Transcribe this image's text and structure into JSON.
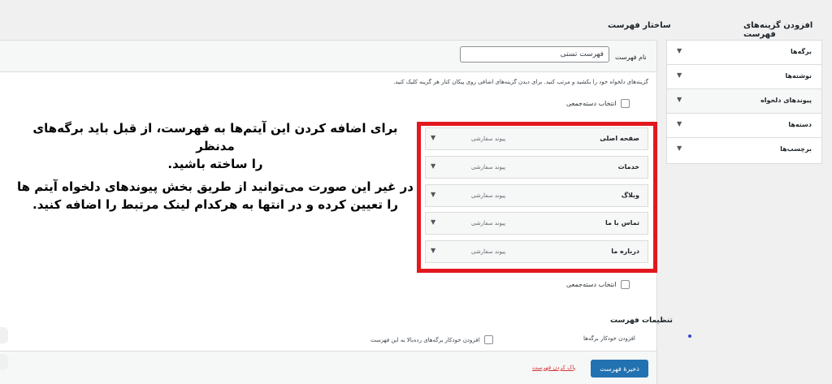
{
  "add_items_panel": {
    "title": "افزودن گزینه‌های فهرست",
    "items": [
      {
        "label": "برگه‌ها",
        "arrow": "▼"
      },
      {
        "label": "نوشته‌ها",
        "arrow": "▼"
      },
      {
        "label": "پیوندهای دلخواه",
        "arrow": "▼"
      },
      {
        "label": "دسته‌ها",
        "arrow": "▼"
      },
      {
        "label": "برچسب‌ها",
        "arrow": "▼"
      }
    ]
  },
  "structure": {
    "title": "ساختار فهرست",
    "menu_name_label": "نام فهرست",
    "menu_name_value": "فهرست تستی",
    "help_text": "گزینه‌های دلخواه خود را بکشید و مرتب کنید. برای دیدن گزینه‌های اضافی روی پیکان کنار هر گزینه کلیک کنید.",
    "bulk_select_label": "انتخاب دسته‌جمعی",
    "items": [
      {
        "title": "صفحه اصلی",
        "type": "پیوند سفارشی",
        "arrow": "▼"
      },
      {
        "title": "خدمات",
        "type": "پیوند سفارشی",
        "arrow": "▼"
      },
      {
        "title": "وبلاگ",
        "type": "پیوند سفارشی",
        "arrow": "▼"
      },
      {
        "title": "تماس با ما",
        "type": "پیوند سفارشی",
        "arrow": "▼"
      },
      {
        "title": "درباره ما",
        "type": "پیوند سفارشی",
        "arrow": "▼"
      }
    ]
  },
  "annotation": {
    "para1_line1": "برای اضافه کردن این آیتم‌ها به فهرست، از قبل باید برگه‌های مدنظر",
    "para1_line2": "را ساخته باشید.",
    "para2_line1": "در غیر این صورت می‌توانید از طریق بخش پیوندهای دلخواه آیتم ها",
    "para2_line2": "را تعیین کرده و در انتها به هرکدام لینک مرتبط را اضافه کنید."
  },
  "settings": {
    "title": "تنظیمات فهرست",
    "auto_add_label": "افزودن خودکار برگه‌ها",
    "auto_add_checkbox": "افزودن خودکار برگه‌های رده‌بالا به این فهرست",
    "save_button": "ذخیرهٔ فهرست",
    "delete_link": "پاک کردن فهرست"
  },
  "colors": {
    "accent": "#2271b1",
    "annotation_border": "#e2171f",
    "delete": "#d63638"
  }
}
